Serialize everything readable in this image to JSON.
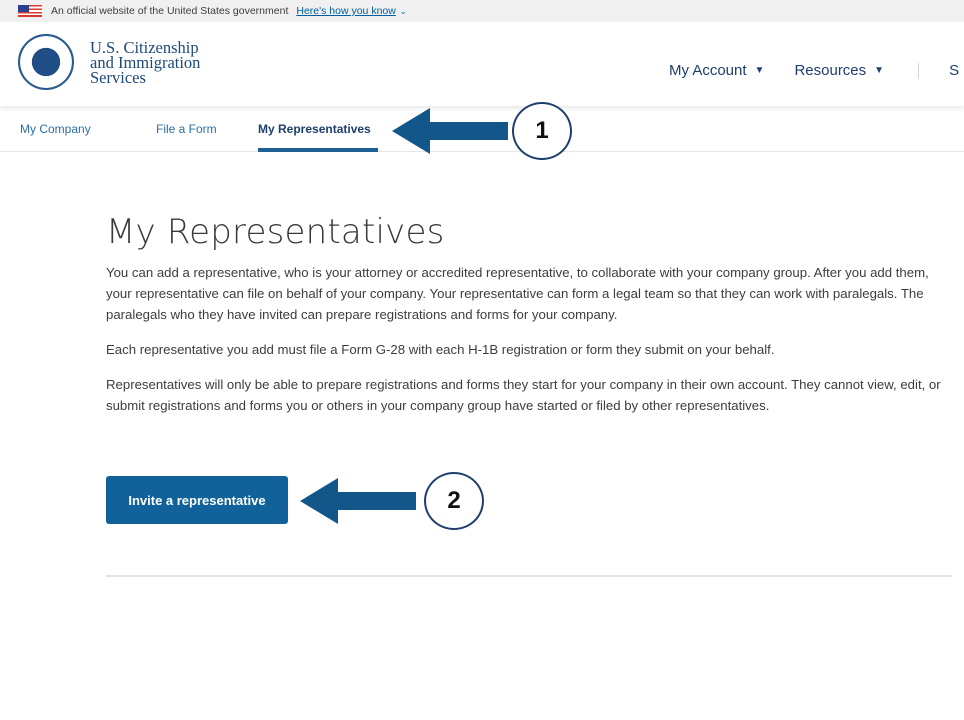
{
  "gov_banner": {
    "text": "An official website of the United States government",
    "link": "Here's how you know",
    "chevron": "⌄"
  },
  "header": {
    "logo_lines": [
      "U.S. Citizenship",
      "and Immigration",
      "Services"
    ],
    "nav": [
      {
        "label": "My Account",
        "caret": "▼"
      },
      {
        "label": "Resources",
        "caret": "▼"
      }
    ],
    "partial_item": "S"
  },
  "subnav": {
    "tabs": [
      {
        "label": "My Company",
        "active": false
      },
      {
        "label": "File a Form",
        "active": false
      },
      {
        "label": "My Representatives",
        "active": true
      }
    ]
  },
  "callouts": [
    {
      "number": "1"
    },
    {
      "number": "2"
    }
  ],
  "main": {
    "title": "My Representatives",
    "paragraphs": [
      "You can add a representative, who is your attorney or accredited representative, to collaborate with your company group. After you add them, your representative can file on behalf of your company. Your representative can form a legal team so that they can work with paralegals. The paralegals who they have invited can prepare registrations and forms for your company.",
      "Each representative you add must file a Form G-28 with each H-1B registration or form they submit on your behalf.",
      "Representatives will only be able to prepare registrations and forms they start for your company in their own account. They cannot view, edit, or submit registrations and forms you or others in your company group have started or filed by other representatives."
    ],
    "invite_button": "Invite a representative"
  },
  "colors": {
    "primary": "#11629a",
    "nav_text": "#1e3f6e",
    "link": "#005ea2",
    "arrow": "#13568a"
  }
}
